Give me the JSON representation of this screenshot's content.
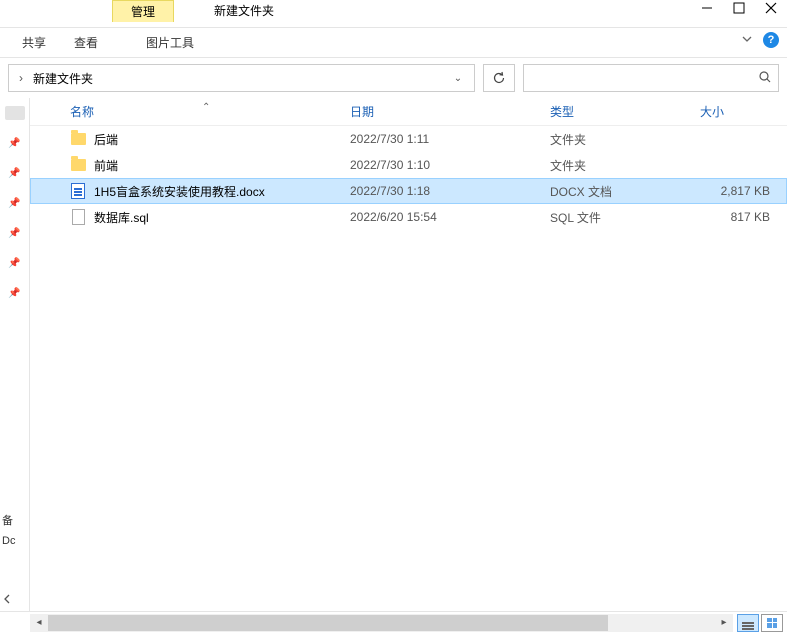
{
  "titlebar": {
    "manage_tab": "管理",
    "title": "新建文件夹"
  },
  "ribbon": {
    "share": "共享",
    "view": "查看",
    "tools": "图片工具"
  },
  "address": {
    "path": "新建文件夹"
  },
  "columns": {
    "name": "名称",
    "date": "日期",
    "type": "类型",
    "size": "大小"
  },
  "rows": [
    {
      "icon": "folder",
      "name": "后端",
      "date": "2022/7/30 1:11",
      "type": "文件夹",
      "size": "",
      "selected": false
    },
    {
      "icon": "folder",
      "name": "前端",
      "date": "2022/7/30 1:10",
      "type": "文件夹",
      "size": "",
      "selected": false
    },
    {
      "icon": "doc",
      "name": "1H5盲盒系统安装使用教程.docx",
      "date": "2022/7/30 1:18",
      "type": "DOCX 文档",
      "size": "2,817 KB",
      "selected": true
    },
    {
      "icon": "file",
      "name": "数据库.sql",
      "date": "2022/6/20 15:54",
      "type": "SQL 文件",
      "size": "817 KB",
      "selected": false
    }
  ],
  "sidebar": {
    "label1": "备",
    "label2": "Dc"
  }
}
